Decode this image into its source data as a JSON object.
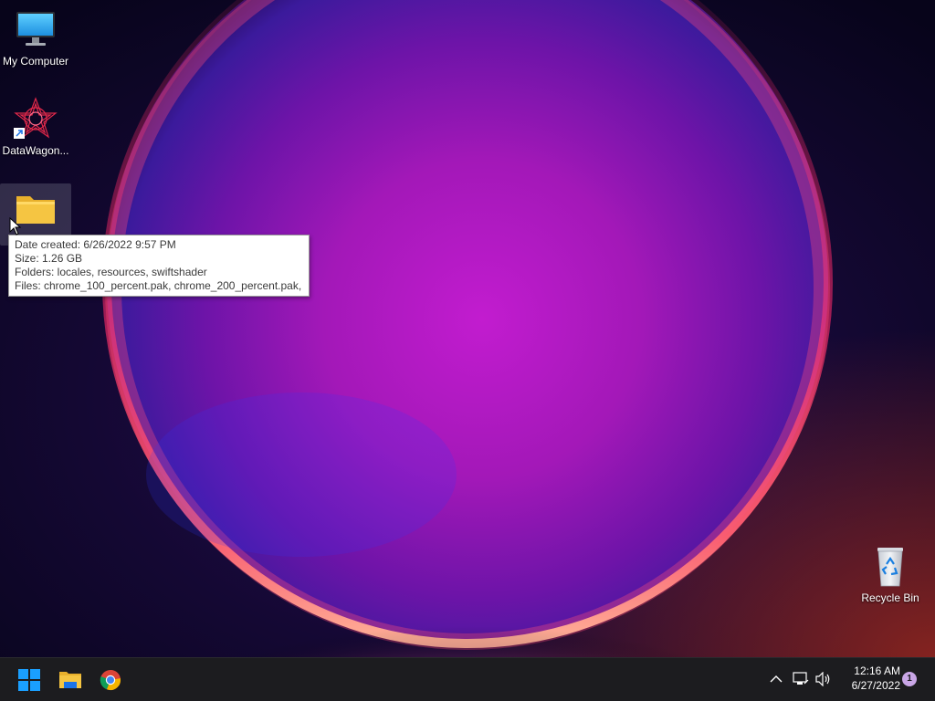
{
  "desktop": {
    "icons": [
      {
        "label": "My Computer",
        "icon": "monitor-icon"
      },
      {
        "label": "DataWagon...",
        "icon": "datawagon-shortcut-icon"
      },
      {
        "label": "",
        "icon": "folder-icon"
      },
      {
        "label": "Recycle Bin",
        "icon": "recycle-bin-icon"
      }
    ],
    "tooltip": {
      "date_created": "Date created: 6/26/2022 9:57 PM",
      "size": "Size: 1.26 GB",
      "folders": "Folders: locales, resources, swiftshader",
      "files": "Files: chrome_100_percent.pak, chrome_200_percent.pak, ..."
    }
  },
  "taskbar": {
    "pinned": [
      {
        "name": "start-button",
        "icon": "windows-logo-icon"
      },
      {
        "name": "file-explorer",
        "icon": "folder-icon"
      },
      {
        "name": "chrome",
        "icon": "chrome-icon"
      }
    ],
    "tray": {
      "icons": [
        "chevron-up-icon",
        "network-icon",
        "volume-icon"
      ],
      "time": "12:16 AM",
      "date": "6/27/2022",
      "notification_count": "1"
    }
  },
  "colors": {
    "taskbar_bg": "#1c1c1f",
    "windows_blue": "#1a9fff",
    "folder_yellow": "#f5c542",
    "notification_badge": "#c9a6e6"
  }
}
